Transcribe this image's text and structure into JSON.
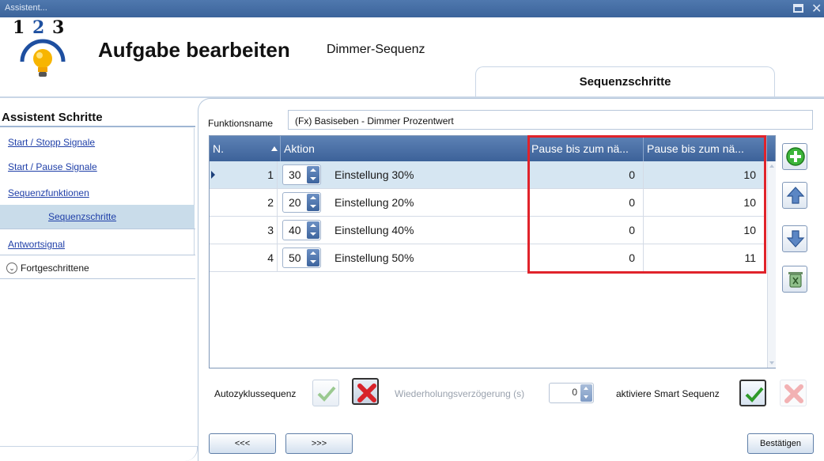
{
  "window": {
    "title": "Assistent...",
    "icons": [
      "maximize-icon",
      "close-icon"
    ]
  },
  "header": {
    "logo_digits": [
      "1",
      "2",
      "3"
    ],
    "title": "Aufgabe bearbeiten",
    "subtitle": "Dimmer-Sequenz",
    "tab": "Sequenzschritte"
  },
  "sidebar": {
    "heading": "Assistent Schritte",
    "items": [
      {
        "label": "Start / Stopp Signale",
        "active": false
      },
      {
        "label": "Start / Pause Signale",
        "active": false
      },
      {
        "label": "Sequenzfunktionen",
        "active": false
      },
      {
        "label": "Sequenzschritte",
        "active": true
      },
      {
        "label": "Antwortsignal",
        "active": false
      }
    ],
    "advanced_label": "Fortgeschrittene"
  },
  "form": {
    "function_name_label": "Funktionsname",
    "function_name_value": "(Fx) Basiseben - Dimmer Prozentwert"
  },
  "grid": {
    "columns": [
      "N.",
      "Aktion",
      "Pause bis zum nä...",
      "Pause bis zum nä..."
    ],
    "rows": [
      {
        "n": "1",
        "value": "30",
        "action": "Einstellung 30%",
        "pause1": "0",
        "pause2": "10",
        "selected": true
      },
      {
        "n": "2",
        "value": "20",
        "action": "Einstellung 20%",
        "pause1": "0",
        "pause2": "10",
        "selected": false
      },
      {
        "n": "3",
        "value": "40",
        "action": "Einstellung 40%",
        "pause1": "0",
        "pause2": "10",
        "selected": false
      },
      {
        "n": "4",
        "value": "50",
        "action": "Einstellung 50%",
        "pause1": "0",
        "pause2": "11",
        "selected": false
      }
    ],
    "highlight_color": "#e0232b"
  },
  "side_buttons": [
    "add-icon",
    "move-up-icon",
    "move-down-icon",
    "delete-icon"
  ],
  "options": {
    "autocycle_label": "Autozyklussequenz",
    "repeat_delay_label": "Wiederholungsverzögerung (s)",
    "repeat_delay_value": "0",
    "smart_sequence_label": "aktiviere Smart Sequenz"
  },
  "nav": {
    "prev_label": "<<<",
    "next_label": ">>>",
    "confirm_label": "Bestätigen"
  },
  "colors": {
    "titlebar": "#3c649b",
    "grid_header": "#4a70a8",
    "link": "#1f3fa8",
    "selected_row": "#d6e6f2"
  }
}
